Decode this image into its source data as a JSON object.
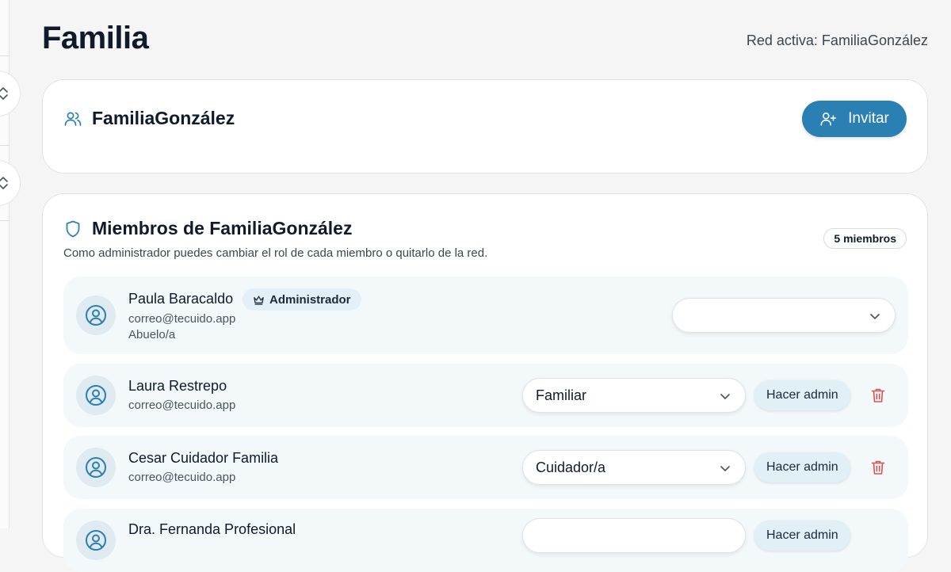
{
  "header": {
    "title": "Familia",
    "active_network": "Red activa: FamiliaGonzález"
  },
  "network_card": {
    "name": "FamiliaGonzález",
    "icon": "users-icon",
    "invite_label": "Invitar"
  },
  "members_card": {
    "title": "Miembros de FamiliaGonzález",
    "subtitle": "Como administrador puedes cambiar el rol de cada miembro o quitarlo de la red.",
    "count_label": "5 miembros",
    "members": [
      {
        "name": "Paula Baracaldo",
        "email": "correo@tecuido.app",
        "relation": "Abuelo/a",
        "badge": "Administrador",
        "role": ""
      },
      {
        "name": "Laura Restrepo",
        "email": "correo@tecuido.app",
        "role": "Familiar",
        "make_admin_label": "Hacer admin"
      },
      {
        "name": "Cesar Cuidador Familia",
        "email": "correo@tecuido.app",
        "role": "Cuidador/a",
        "make_admin_label": "Hacer admin"
      },
      {
        "name": "Dra. Fernanda Profesional",
        "email": "",
        "role": "",
        "make_admin_label": "Hacer admin"
      }
    ]
  },
  "colors": {
    "accent": "#2a7fb3",
    "danger": "#d9534f",
    "background": "#f4f5f4"
  }
}
